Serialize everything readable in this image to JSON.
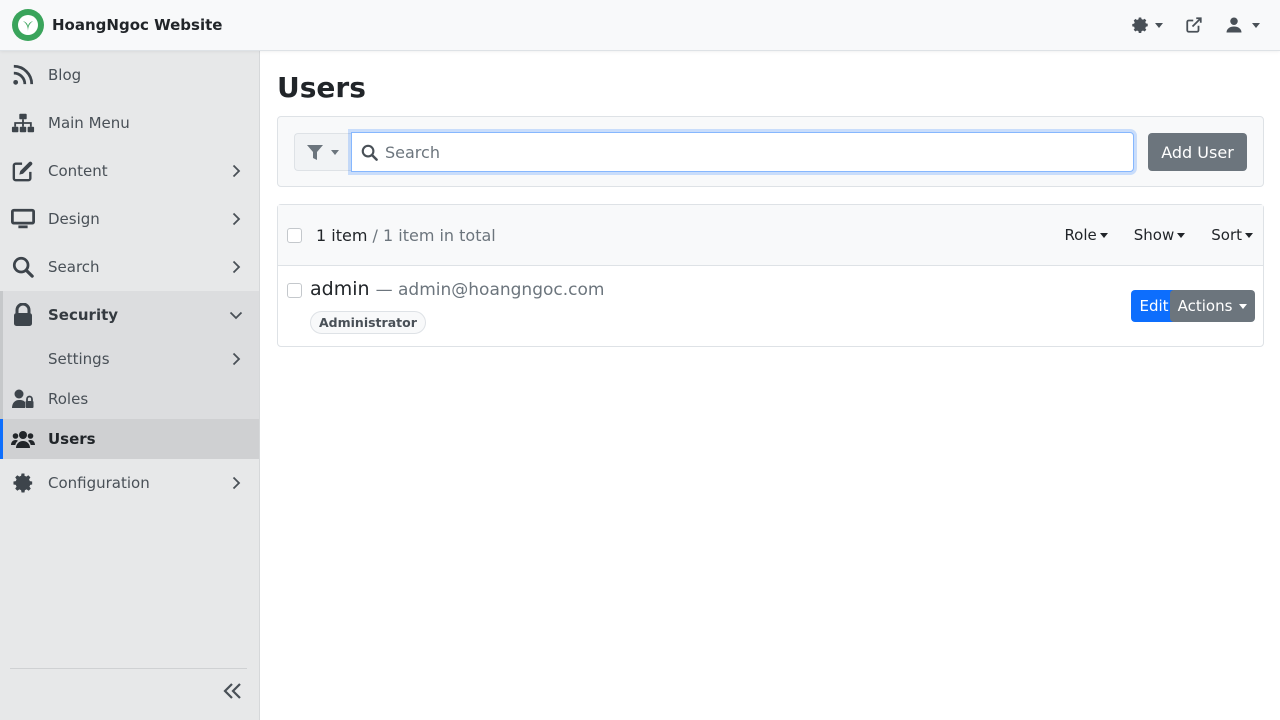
{
  "header": {
    "site_name": "HoangNgoc Website",
    "icons": {
      "logo": "leaf-logo",
      "theme": "gear-icon",
      "external": "external-link-icon",
      "user": "user-icon"
    }
  },
  "sidebar": {
    "items": [
      {
        "label": "Blog",
        "icon": "rss-icon"
      },
      {
        "label": "Main Menu",
        "icon": "sitemap-icon"
      },
      {
        "label": "Content",
        "icon": "edit-icon"
      },
      {
        "label": "Design",
        "icon": "monitor-icon"
      },
      {
        "label": "Search",
        "icon": "search-icon"
      },
      {
        "label": "Security",
        "icon": "lock-icon"
      },
      {
        "label": "Configuration",
        "icon": "cog-icon"
      }
    ],
    "security_children": [
      {
        "label": "Settings"
      },
      {
        "label": "Roles",
        "icon": "user-lock-icon"
      },
      {
        "label": "Users",
        "icon": "users-icon"
      }
    ],
    "active_item": "Users"
  },
  "main": {
    "title": "Users",
    "search": {
      "placeholder": "Search",
      "value": ""
    },
    "add_button": "Add User",
    "list": {
      "count_prefix": "1 item",
      "count_suffix": " / 1 item in total",
      "filters": [
        "Role",
        "Show",
        "Sort"
      ],
      "rows": [
        {
          "name": "admin",
          "email": "— admin@hoangngoc.com",
          "role": "Administrator",
          "edit_label": "Edit",
          "actions_label": "Actions"
        }
      ]
    }
  },
  "colors": {
    "primary": "#0d6efd",
    "secondary": "#6c757d",
    "brand": "#3aa45b"
  }
}
